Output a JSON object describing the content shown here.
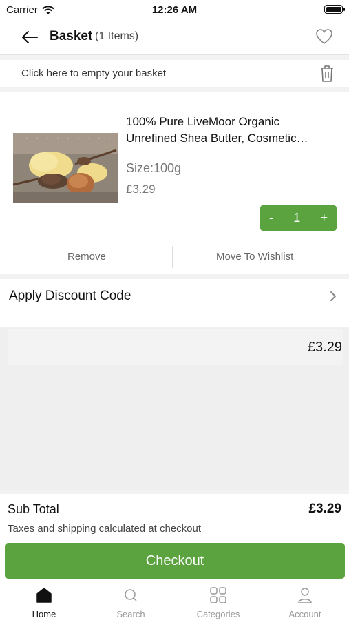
{
  "status_bar": {
    "carrier": "Carrier",
    "time": "12:26 AM"
  },
  "header": {
    "title": "Basket",
    "count": "(1 Items)"
  },
  "empty_basket": {
    "label": "Click here to empty your basket"
  },
  "item": {
    "title": "100% Pure LiveMoor Organic Unrefined Shea Butter, Cosmetic…",
    "size": "Size:100g",
    "price": "£3.29",
    "quantity": "1",
    "minus": "-",
    "plus": "+",
    "remove_label": "Remove",
    "wishlist_label": "Move To Wishlist"
  },
  "discount": {
    "label": "Apply Discount Code"
  },
  "summary": {
    "price": "£3.29"
  },
  "totals": {
    "subtotal_label": "Sub Total",
    "subtotal_value": "£3.29",
    "tax_note": "Taxes and shipping calculated at checkout",
    "checkout_label": "Checkout"
  },
  "tabs": [
    {
      "label": "Home",
      "icon": "home-icon",
      "active": true
    },
    {
      "label": "Search",
      "icon": "search-icon",
      "active": false
    },
    {
      "label": "Categories",
      "icon": "categories-icon",
      "active": false
    },
    {
      "label": "Account",
      "icon": "account-icon",
      "active": false
    }
  ],
  "colors": {
    "accent": "#5aa33f",
    "background": "#f2f2f2"
  }
}
